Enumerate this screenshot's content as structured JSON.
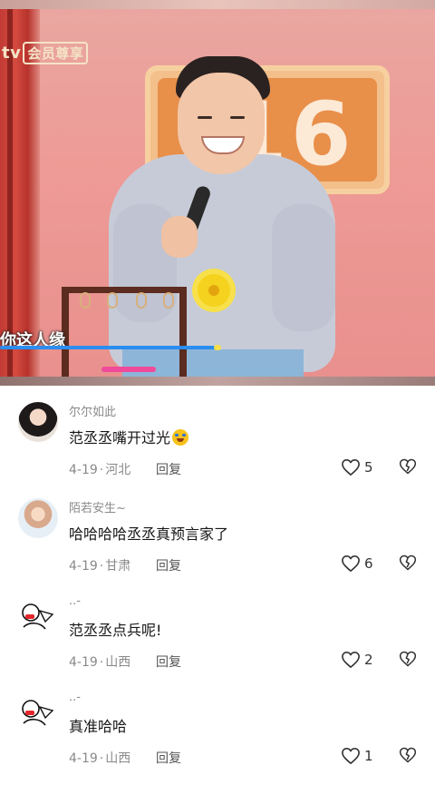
{
  "video": {
    "watermark_prefix": "tv",
    "watermark_badge": "会员尊享",
    "sign_text": "16",
    "subtitle": "你这人缘"
  },
  "comments": [
    {
      "username": "尔尔如此",
      "text": "范丞丞嘴开过光",
      "emoji": "crying-laughing-emoji",
      "date": "4-19",
      "location": "河北",
      "reply_label": "回复",
      "likes": "5"
    },
    {
      "username": "陌若安生~",
      "text": "哈哈哈哈丞丞真预言家了",
      "date": "4-19",
      "location": "甘肃",
      "reply_label": "回复",
      "likes": "6"
    },
    {
      "username": "..-",
      "text": "范丞丞点兵呢!",
      "date": "4-19",
      "location": "山西",
      "reply_label": "回复",
      "likes": "2"
    },
    {
      "username": "..-",
      "text": "真准哈哈",
      "date": "4-19",
      "location": "山西",
      "reply_label": "回复",
      "likes": "1"
    }
  ],
  "colors": {
    "video_bg": "#ee9a96",
    "text_primary": "#161616",
    "text_secondary": "#8a8a8a",
    "subtitle_bar": "#2b8df0"
  },
  "icons": {
    "like": "heart-outline-icon",
    "dislike": "broken-heart-icon"
  }
}
